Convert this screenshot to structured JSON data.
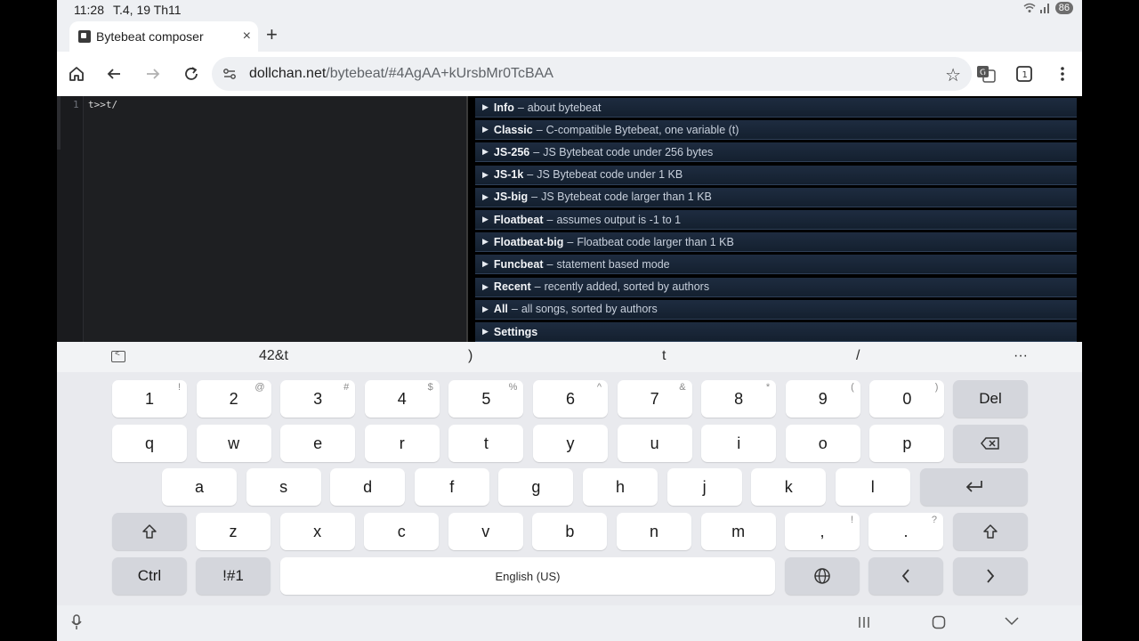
{
  "status": {
    "time": "11:28",
    "date": "T.4, 19 Th11",
    "battery": "86"
  },
  "tab": {
    "title": "Bytebeat composer",
    "close": "×",
    "new_tab": "+"
  },
  "toolbar": {
    "url_host": "dollchan.net",
    "url_path": "/bytebeat/#4AgAA+kUrsbMr0TcBAA"
  },
  "editor": {
    "line_number": "1",
    "code": "t>>t/"
  },
  "library": {
    "items": [
      {
        "name": "Info",
        "desc": "about bytebeat"
      },
      {
        "name": "Classic",
        "desc": "C-compatible Bytebeat, one variable (t)"
      },
      {
        "name": "JS-256",
        "desc": "JS Bytebeat code under 256 bytes"
      },
      {
        "name": "JS-1k",
        "desc": "JS Bytebeat code under 1 KB"
      },
      {
        "name": "JS-big",
        "desc": "JS Bytebeat code larger than 1 KB"
      },
      {
        "name": "Floatbeat",
        "desc": "assumes output is -1 to 1"
      },
      {
        "name": "Floatbeat-big",
        "desc": "Floatbeat code larger than 1 KB"
      },
      {
        "name": "Funcbeat",
        "desc": "statement based mode"
      },
      {
        "name": "Recent",
        "desc": "recently added, sorted by authors"
      },
      {
        "name": "All",
        "desc": "all songs, sorted by authors"
      },
      {
        "name": "Settings",
        "desc": ""
      }
    ],
    "separator": "–",
    "triangle": "▶"
  },
  "suggestions": {
    "s1": "42&t",
    "s2": ")",
    "s3": "t",
    "s4": "/",
    "more": "···"
  },
  "keyboard": {
    "row1": [
      {
        "k": "1",
        "s": "!"
      },
      {
        "k": "2",
        "s": "@"
      },
      {
        "k": "3",
        "s": "#"
      },
      {
        "k": "4",
        "s": "$"
      },
      {
        "k": "5",
        "s": "%"
      },
      {
        "k": "6",
        "s": "^"
      },
      {
        "k": "7",
        "s": "&"
      },
      {
        "k": "8",
        "s": "*"
      },
      {
        "k": "9",
        "s": "("
      },
      {
        "k": "0",
        "s": ")"
      }
    ],
    "del": "Del",
    "row2": [
      "q",
      "w",
      "e",
      "r",
      "t",
      "y",
      "u",
      "i",
      "o",
      "p"
    ],
    "row3": [
      "a",
      "s",
      "d",
      "f",
      "g",
      "h",
      "j",
      "k",
      "l"
    ],
    "row4": [
      "z",
      "x",
      "c",
      "v",
      "b",
      "n",
      "m"
    ],
    "comma": {
      "k": ",",
      "s": "!"
    },
    "period": {
      "k": ".",
      "s": "?"
    },
    "ctrl": "Ctrl",
    "sym": "!#1",
    "space": "English (US)"
  }
}
